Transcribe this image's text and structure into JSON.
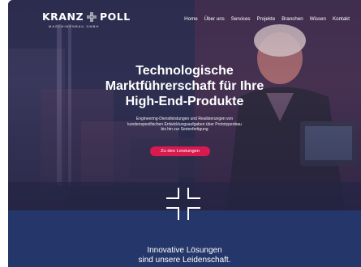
{
  "brand": {
    "name_left": "KRANZ",
    "name_right": "POLL",
    "tagline": "MASCHINENBAU GMBH"
  },
  "nav": {
    "items": [
      {
        "label": "Home"
      },
      {
        "label": "Über uns"
      },
      {
        "label": "Services"
      },
      {
        "label": "Projekte"
      },
      {
        "label": "Branchen"
      },
      {
        "label": "Wissen"
      },
      {
        "label": "Kontakt"
      }
    ]
  },
  "hero": {
    "title_line1": "Technologische",
    "title_line2": "Marktführerschaft für Ihre",
    "title_line3": "High-End-Produkte",
    "subtitle_line1": "Engineering-Dienstleistungen und Realisierungen von",
    "subtitle_line2": "kundenspezifischen Entwicklungsaufgaben über Prototypenbau",
    "subtitle_line3": "bis hin zur Serienfertigung",
    "cta_label": "Zu den Leistungen"
  },
  "section": {
    "heading_line1": "Innovative Lösungen",
    "heading_line2": "sind unsere Leidenschaft."
  },
  "colors": {
    "accent": "#d81a4e",
    "section_bg": "#24366a",
    "hero_overlay": "#2b2e4e"
  },
  "icons": {
    "logo_mark": "cross-icon",
    "section_mark": "cross-divider-icon"
  }
}
